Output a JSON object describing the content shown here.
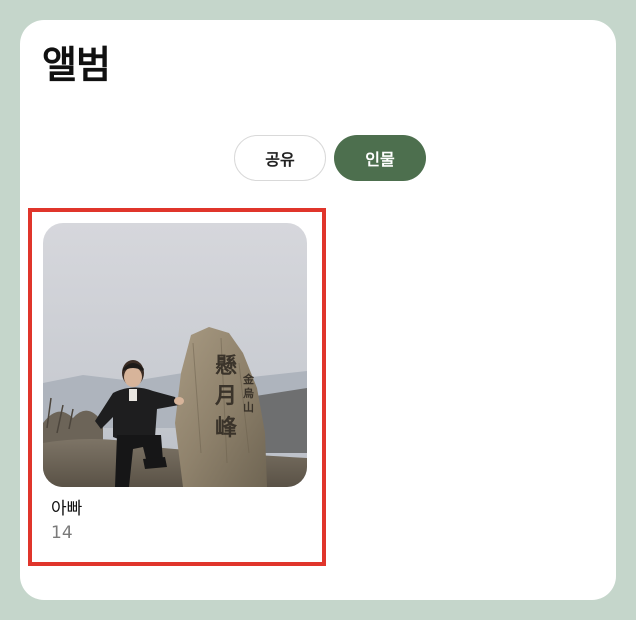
{
  "header": {
    "title": "앨범"
  },
  "tabs": {
    "shared_label": "공유",
    "people_label": "인물",
    "selected": "인물"
  },
  "albums": [
    {
      "name": "아빠",
      "count": "14"
    }
  ],
  "colors": {
    "active_tab": "#4d6f4e",
    "highlight": "#e0352b",
    "frame": "#c5d6cb"
  }
}
